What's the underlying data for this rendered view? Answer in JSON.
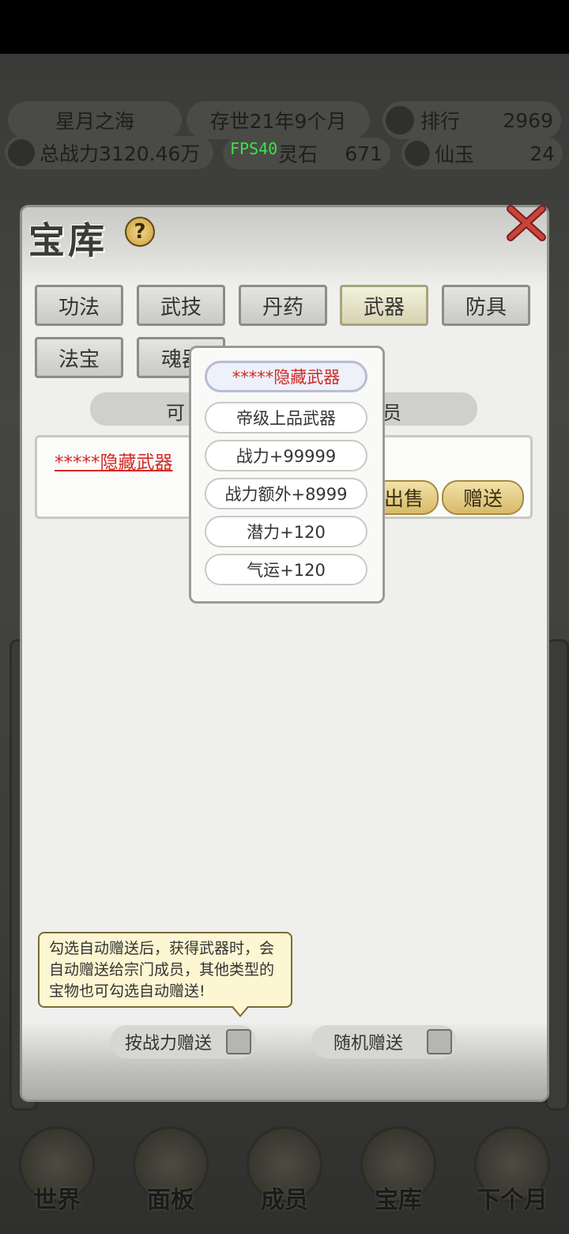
{
  "header": {
    "location": "星月之海",
    "era": "存世21年9个月",
    "rank_label": "排行",
    "rank_value": "2969",
    "power": "总战力3120.46万",
    "fps": "FPS40",
    "stone_label": "灵石",
    "stone_value": "671",
    "jade_label": "仙玉",
    "jade_value": "24"
  },
  "dialog": {
    "title": "宝库",
    "help": "?",
    "tabs": [
      {
        "label": "功法"
      },
      {
        "label": "武技"
      },
      {
        "label": "丹药"
      },
      {
        "label": "武器",
        "active": true
      },
      {
        "label": "防具"
      },
      {
        "label": "法宝"
      },
      {
        "label": "魂器"
      }
    ],
    "ribbon_left": "可",
    "ribbon_right": "员",
    "item": {
      "name": "*****隐藏武器",
      "plus": "+",
      "sell_label": "出售",
      "gift_label": "赠送"
    },
    "tooltip": "勾选自动赠送后，获得武器时，会自动赠送给宗门成员，其他类型的宝物也可勾选自动赠送!",
    "options": {
      "by_power": "按战力赠送",
      "random": "随机赠送"
    }
  },
  "popup": {
    "attributes": [
      "*****隐藏武器",
      "帝级上品武器",
      "战力+99999",
      "战力额外+8999",
      "潜力+120",
      "气运+120"
    ]
  },
  "bottom_nav": [
    {
      "label": "世界"
    },
    {
      "label": "面板"
    },
    {
      "label": "成员"
    },
    {
      "label": "宝库"
    },
    {
      "label": "下个月"
    }
  ],
  "colors": {
    "accent_red": "#d12a24",
    "fps_green": "#3ee04a",
    "gold_button": "#d8b96a"
  }
}
